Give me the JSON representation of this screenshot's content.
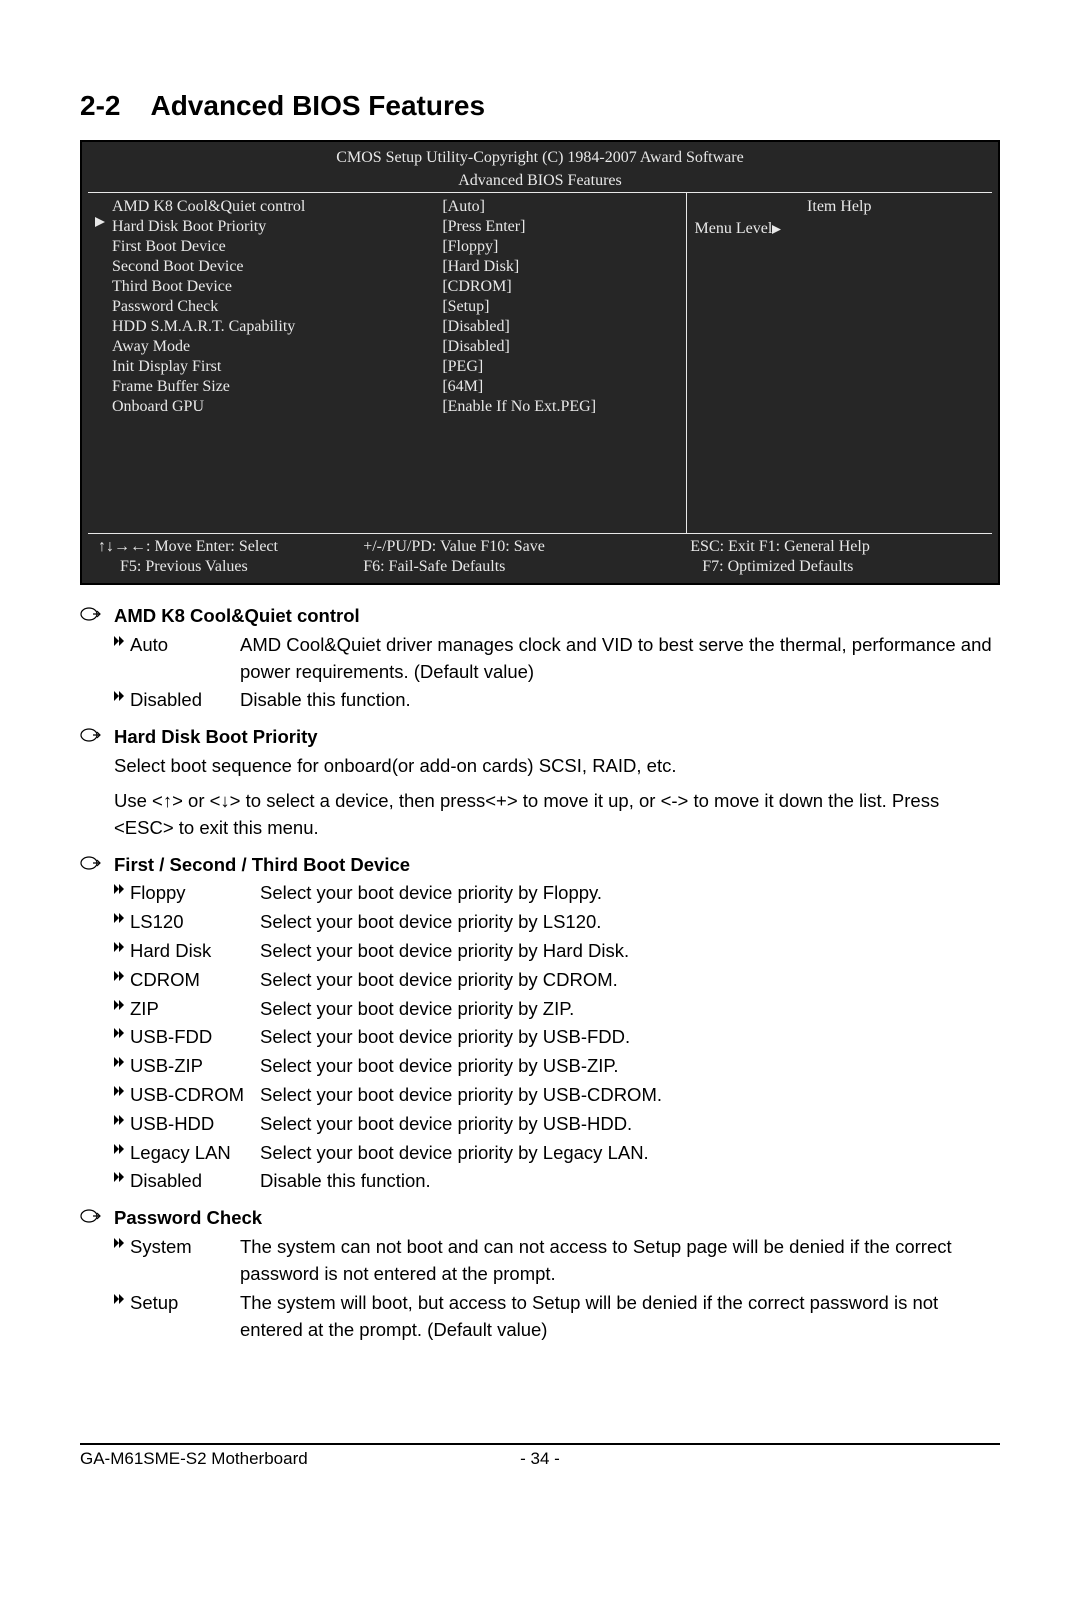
{
  "heading": {
    "number": "2-2",
    "title": "Advanced BIOS Features"
  },
  "bios": {
    "copyright": "CMOS Setup Utility-Copyright (C) 1984-2007 Award Software",
    "subtitle": "Advanced BIOS Features",
    "settings": [
      {
        "label": "AMD K8 Cool&Quiet control",
        "value": "[Auto]"
      },
      {
        "label": "Hard Disk Boot Priority",
        "value": "[Press Enter]"
      },
      {
        "label": "First Boot Device",
        "value": "[Floppy]"
      },
      {
        "label": "Second Boot Device",
        "value": "[Hard Disk]"
      },
      {
        "label": "Third Boot Device",
        "value": "[CDROM]"
      },
      {
        "label": "Password Check",
        "value": "[Setup]"
      },
      {
        "label": "HDD S.M.A.R.T. Capability",
        "value": "[Disabled]"
      },
      {
        "label": "Away Mode",
        "value": "[Disabled]"
      },
      {
        "label": "Init Display First",
        "value": "[PEG]"
      },
      {
        "label": "Frame Buffer Size",
        "value": "[64M]"
      },
      {
        "label": "Onboard GPU",
        "value": "[Enable If No Ext.PEG]"
      }
    ],
    "help_title": "Item Help",
    "menu_level": "Menu Level",
    "footer": {
      "c1a": "↑↓→←: Move       Enter: Select",
      "c1b": "F5: Previous Values",
      "c2a": "+/-/PU/PD: Value        F10: Save",
      "c2b": "F6: Fail-Safe Defaults",
      "c3a": "ESC: Exit         F1: General Help",
      "c3b": "F7: Optimized Defaults"
    }
  },
  "sections": [
    {
      "title": "AMD K8 Cool&Quiet control",
      "options": [
        {
          "label": "Auto",
          "desc": "AMD Cool&Quiet driver manages clock and VID to best serve the thermal, performance and power requirements. (Default value)"
        },
        {
          "label": "Disabled",
          "desc": "Disable this function."
        }
      ]
    },
    {
      "title": "Hard Disk Boot Priority",
      "paragraphs": [
        "Select boot sequence for onboard(or add-on cards) SCSI, RAID, etc.",
        "Use <↑> or <↓> to select a device, then press<+> to move it up, or <-> to move it down the list. Press <ESC> to exit this menu."
      ]
    },
    {
      "title": "First / Second / Third Boot Device",
      "wide": true,
      "options": [
        {
          "label": "Floppy",
          "desc": "Select your boot device priority by Floppy."
        },
        {
          "label": "LS120",
          "desc": "Select your boot device priority by LS120."
        },
        {
          "label": "Hard Disk",
          "desc": "Select your boot device priority by Hard Disk."
        },
        {
          "label": "CDROM",
          "desc": "Select your boot device priority by CDROM."
        },
        {
          "label": "ZIP",
          "desc": "Select your boot device priority by ZIP."
        },
        {
          "label": "USB-FDD",
          "desc": "Select your boot device priority by USB-FDD."
        },
        {
          "label": "USB-ZIP",
          "desc": "Select your boot device priority by USB-ZIP."
        },
        {
          "label": "USB-CDROM",
          "desc": "Select your boot device priority by USB-CDROM."
        },
        {
          "label": "USB-HDD",
          "desc": "Select your boot device priority by USB-HDD."
        },
        {
          "label": "Legacy LAN",
          "desc": "Select your boot device priority by Legacy LAN."
        },
        {
          "label": "Disabled",
          "desc": "Disable this function."
        }
      ]
    },
    {
      "title": "Password Check",
      "options": [
        {
          "label": "System",
          "desc": "The system can not boot and can not access to Setup page will be denied if the correct password is not entered at the prompt."
        },
        {
          "label": "Setup",
          "desc": "The system will boot, but access to Setup will be denied if the correct password is not entered at the prompt. (Default value)"
        }
      ]
    }
  ],
  "footer": {
    "model": "GA-M61SME-S2 Motherboard",
    "page": "- 34 -"
  }
}
